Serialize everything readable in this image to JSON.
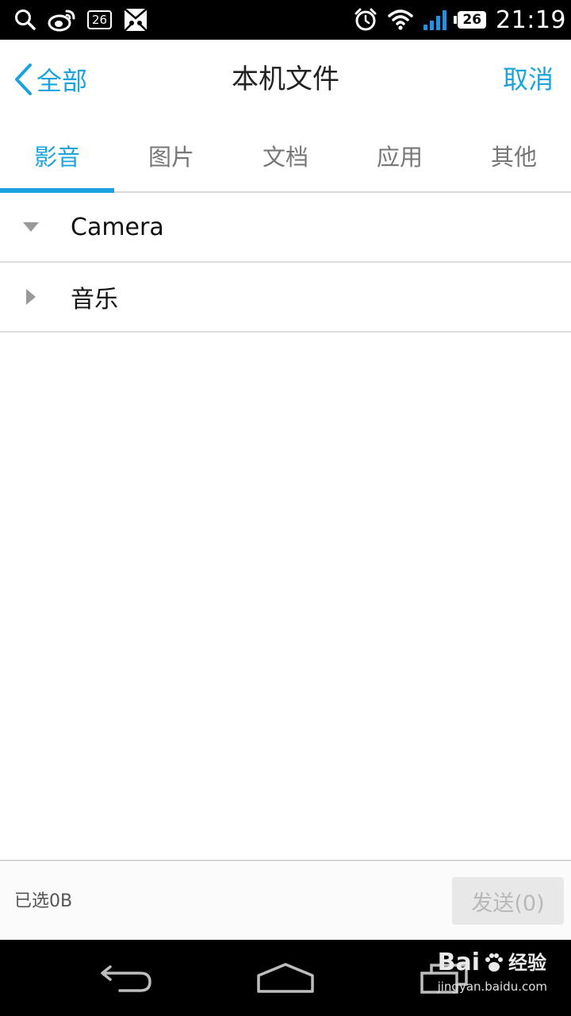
{
  "status_bar": {
    "weibo_badge": "26",
    "battery": "26",
    "time": "21:19"
  },
  "header": {
    "back_label": "全部",
    "title": "本机文件",
    "cancel_label": "取消"
  },
  "tabs": [
    {
      "label": "影音",
      "active": true
    },
    {
      "label": "图片",
      "active": false
    },
    {
      "label": "文档",
      "active": false
    },
    {
      "label": "应用",
      "active": false
    },
    {
      "label": "其他",
      "active": false
    }
  ],
  "folders": [
    {
      "label": "Camera",
      "expanded": true
    },
    {
      "label": "音乐",
      "expanded": false
    }
  ],
  "footer": {
    "selected_text": "已选0B",
    "send_label": "发送(0)"
  },
  "watermark": {
    "logo_text": "Bai",
    "logo_suffix": "经验",
    "url": "jingyan.baidu.com"
  },
  "colors": {
    "accent": "#1aa3dc",
    "text": "#222222",
    "tab_inactive": "#777777",
    "divider": "#dcdcdc"
  }
}
